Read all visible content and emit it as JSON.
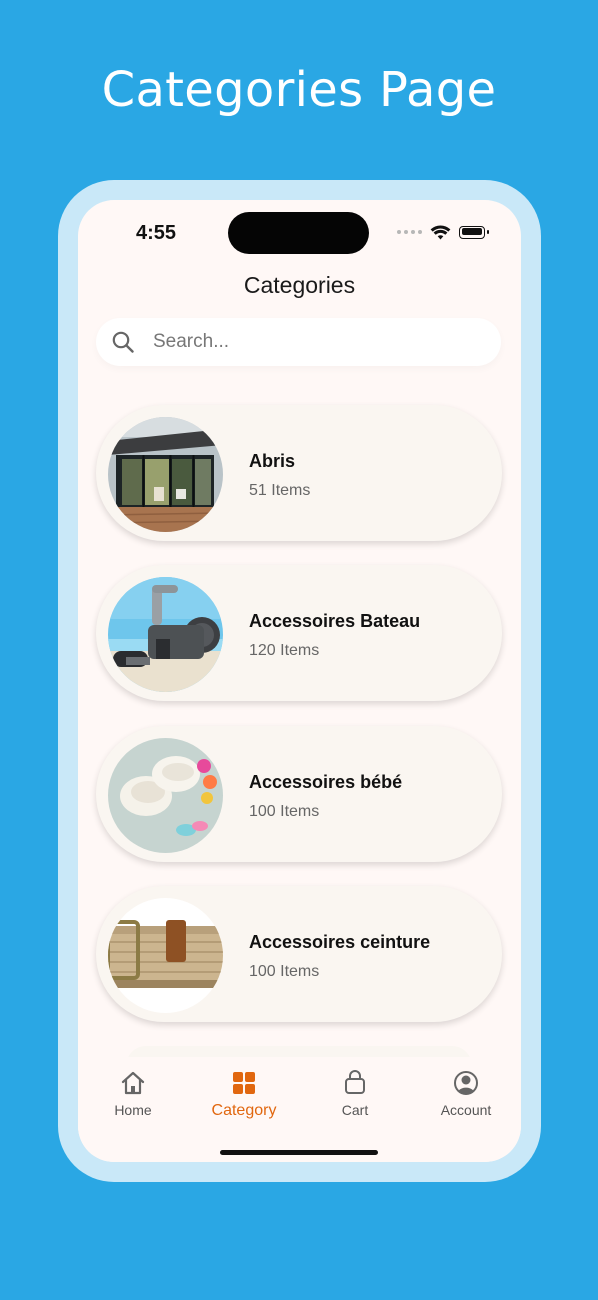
{
  "promo": {
    "title": "Categories Page"
  },
  "colors": {
    "background": "#2AA7E4",
    "frame": "#C9E8F8",
    "screen": "#FFF8F6",
    "card": "#FAF6F1",
    "accent": "#E1670F"
  },
  "status_bar": {
    "time": "4:55",
    "icons": [
      "signal-dots-icon",
      "wifi-icon",
      "battery-icon"
    ]
  },
  "header": {
    "title": "Categories"
  },
  "search": {
    "value": "",
    "placeholder": "Search...",
    "icon": "search-icon"
  },
  "categories": [
    {
      "name": "Abris",
      "count": "51 Items",
      "image": "patio-shelter-image"
    },
    {
      "name": "Accessoires Bateau",
      "count": "120 Items",
      "image": "boat-winch-image"
    },
    {
      "name": "Accessoires bébé",
      "count": "100 Items",
      "image": "baby-shoes-image"
    },
    {
      "name": "Accessoires ceinture",
      "count": "100 Items",
      "image": "woven-belt-image"
    }
  ],
  "tab_bar": {
    "active": "Category",
    "items": [
      {
        "label": "Home",
        "icon": "home-icon"
      },
      {
        "label": "Category",
        "icon": "grid-icon"
      },
      {
        "label": "Cart",
        "icon": "shopping-bag-icon"
      },
      {
        "label": "Account",
        "icon": "account-icon"
      }
    ]
  }
}
